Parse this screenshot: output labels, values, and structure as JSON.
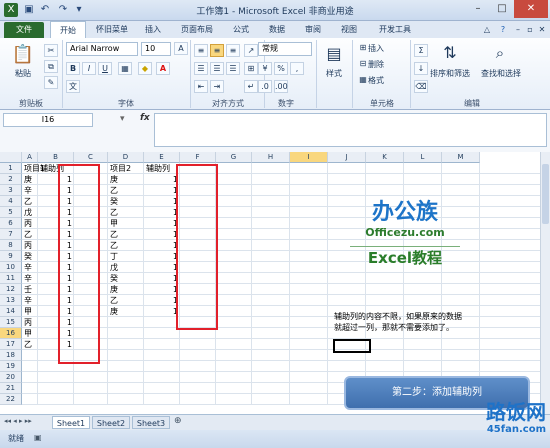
{
  "window": {
    "title": "工作簿1 - Microsoft Excel 非商业用途",
    "controls": [
      "minimize",
      "maximize",
      "close"
    ]
  },
  "quick_access": [
    "save-icon",
    "undo-icon",
    "redo-icon",
    "customize-icon"
  ],
  "tabs": {
    "file": "文件",
    "items": [
      "开始",
      "怀旧菜单",
      "插入",
      "页面布局",
      "公式",
      "数据",
      "审阅",
      "视图",
      "开发工具"
    ]
  },
  "ribbon": {
    "clipboard": {
      "paste": "粘贴",
      "label": "剪贴板"
    },
    "font": {
      "name": "Arial Narrow",
      "size": "10",
      "label": "字体"
    },
    "alignment": {
      "label": "对齐方式"
    },
    "number": {
      "format": "常规",
      "label": "数字"
    },
    "styles": {
      "button": "样式"
    },
    "cells": {
      "insert": "插入",
      "delete": "删除",
      "format": "格式",
      "label": "单元格"
    },
    "editing": {
      "sort": "排序和筛选",
      "find": "查找和选择",
      "label": "编辑"
    }
  },
  "formula_bar": {
    "name_box": "I16",
    "fx": "fx",
    "value": ""
  },
  "columns": [
    "A",
    "B",
    "C",
    "D",
    "E",
    "F",
    "G",
    "H",
    "I",
    "J",
    "K",
    "L",
    "M"
  ],
  "rows": [
    "1",
    "2",
    "3",
    "4",
    "5",
    "6",
    "7",
    "8",
    "9",
    "10",
    "11",
    "12",
    "13",
    "14",
    "15",
    "16",
    "17",
    "18",
    "19",
    "20",
    "21",
    "22"
  ],
  "table1": {
    "headers": [
      "项目1",
      "辅助列"
    ],
    "items": [
      "庚",
      "辛",
      "乙",
      "戊",
      "丙",
      "乙",
      "丙",
      "癸",
      "辛",
      "辛",
      "壬",
      "辛",
      "甲",
      "丙",
      "甲",
      "乙"
    ],
    "values": [
      "1",
      "1",
      "1",
      "1",
      "1",
      "1",
      "1",
      "1",
      "1",
      "1",
      "1",
      "1",
      "1",
      "1",
      "1",
      "1"
    ]
  },
  "table2": {
    "headers": [
      "项目2",
      "辅助列"
    ],
    "items": [
      "庚",
      "乙",
      "癸",
      "乙",
      "甲",
      "乙",
      "乙",
      "丁",
      "戊",
      "癸",
      "庚",
      "乙",
      "庚"
    ],
    "values": [
      "1",
      "1",
      "1",
      "1",
      "1",
      "1",
      "1",
      "1",
      "1",
      "1",
      "1",
      "1",
      "1"
    ]
  },
  "note": {
    "line1": "辅助列的内容不限，如果原来的数据",
    "line2": "就超过一列，那就不需要添加了。"
  },
  "logo": {
    "main": "办公族",
    "domain": "Officezu.com",
    "sub": "Excel教程"
  },
  "step": "第二步：添加辅助列",
  "sheets": [
    "Sheet1",
    "Sheet2",
    "Sheet3"
  ],
  "status": {
    "ready": "就绪"
  },
  "watermark": {
    "text": "路饭网",
    "url": "45fan.com"
  },
  "colors": {
    "accent": "#2a6b2e",
    "highlight": "#e2202a",
    "step_bg": "#4f7fbe"
  }
}
